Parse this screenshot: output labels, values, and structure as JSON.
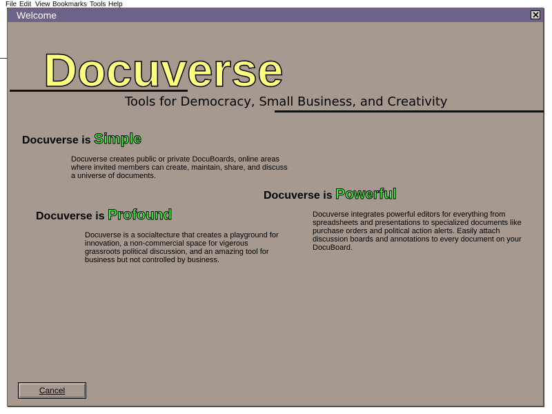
{
  "menubar": {
    "items": [
      "File",
      "Edit",
      "View",
      "Bookmarks",
      "Tools",
      "Help"
    ]
  },
  "dialog": {
    "title": "Welcome",
    "close_label": "×"
  },
  "logo": {
    "text": "Docuverse"
  },
  "tagline": "Tools for Democracy, Small Business, and Creativity",
  "sections": {
    "simple": {
      "prefix": "Docuverse is ",
      "keyword": "Simple",
      "body": "Docuverse creates public or private DocuBoards, online areas where invited members can create, maintain, share, and discuss a universe of documents."
    },
    "powerful": {
      "prefix": "Docuverse is ",
      "keyword": "Powerful",
      "body": "Docuverse integrates powerful editors for everything from spreadsheets and presentations to specialized documents like purchase orders and political action alerts.  Easily attach discussion boards and annotations to every document on your DocuBoard."
    },
    "profound": {
      "prefix": "Docuverse is ",
      "keyword": "Profound",
      "body": "Docuverse is a socialtecture that creates a playground for innovation, a non-commercial space for vigerous grassroots political discussion, and an amazing tool for business but not controlled by business."
    }
  },
  "buttons": {
    "cancel": "Cancel"
  },
  "colors": {
    "dialog_bg": "#a69a90",
    "titlebar": "#6f6288",
    "logo_fill": "#ffff80",
    "accent_green": "#33ff33"
  }
}
